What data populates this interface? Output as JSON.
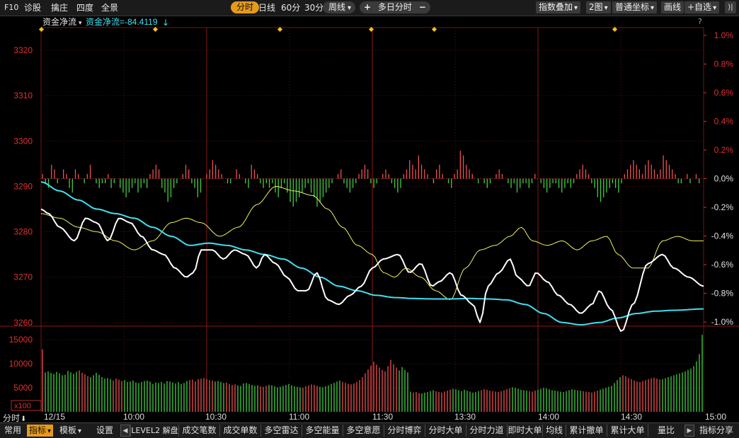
{
  "toolbar": {
    "f10": "F10",
    "diagnose": "诊股",
    "dragon": "擒庄",
    "four_degree": "四度",
    "panorama": "全景",
    "tabs": [
      {
        "label": "分时",
        "active": true
      },
      {
        "label": "日线",
        "active": false
      },
      {
        "label": "60分",
        "active": false
      },
      {
        "label": "30分",
        "active": false
      },
      {
        "label": "周线",
        "active": false
      }
    ],
    "multi_day": "多日分时",
    "plus_glyph": "+",
    "minus_glyph": "−",
    "index_overlay": "指数叠加",
    "two_charts": "2图",
    "coord_mode": "普通坐标",
    "draw_line": "画线",
    "self_select": "+自选",
    "collapse_glyph": "⟩|",
    "dropdown_glyph": "▾"
  },
  "legend": {
    "indicator_name": "资金净流",
    "indicator_value": "资金净流=-84.4119",
    "value_arrow": "↓",
    "help": "?"
  },
  "colors": {
    "price_line": "#ffffff",
    "avg_line": "#f0f060",
    "fund_line": "#40e0f0",
    "up": "#f05050",
    "down": "#40d040",
    "grid": "#7a1010",
    "axis_red": "#e03030",
    "accent": "#e79a1a",
    "marker": "#f0c020"
  },
  "chart_data": {
    "type": "line",
    "price_axis": {
      "ticks": [
        3320,
        3310,
        3300,
        3290,
        3280,
        3270,
        3260
      ],
      "ylim": [
        3259.5,
        3325
      ]
    },
    "pct_axis": {
      "ticks": [
        "1.0%",
        "0.8%",
        "0.6%",
        "0.4%",
        "0.2%",
        "0.0%",
        "-0.2%",
        "-0.4%",
        "-0.6%",
        "-0.8%",
        "-1.0%"
      ]
    },
    "time_ticks": [
      "12/15",
      "10:00",
      "10:30",
      "11:00",
      "11:30",
      "13:30",
      "14:00",
      "14:30",
      "15:00"
    ],
    "time_label": "分时",
    "time_arrow": "⬇",
    "n_points": 241,
    "price_series": {
      "anchors": [
        [
          0,
          3285
        ],
        [
          4,
          3284
        ],
        [
          10,
          3281
        ],
        [
          18,
          3278
        ],
        [
          24,
          3283
        ],
        [
          30,
          3282
        ],
        [
          36,
          3278
        ],
        [
          42,
          3283
        ],
        [
          48,
          3282
        ],
        [
          54,
          3279
        ],
        [
          60,
          3276
        ],
        [
          66,
          3275
        ],
        [
          72,
          3272
        ],
        [
          78,
          3270
        ],
        [
          82,
          3271
        ],
        [
          86,
          3276
        ],
        [
          92,
          3276
        ],
        [
          98,
          3274
        ],
        [
          104,
          3276
        ],
        [
          110,
          3275
        ],
        [
          116,
          3272
        ],
        [
          120,
          3275
        ],
        [
          126,
          3273
        ],
        [
          132,
          3270
        ],
        [
          138,
          3267
        ],
        [
          143,
          3267
        ],
        [
          148,
          3271
        ],
        [
          154,
          3265
        ],
        [
          160,
          3264
        ],
        [
          166,
          3266
        ],
        [
          172,
          3268
        ],
        [
          178,
          3272
        ],
        [
          184,
          3274
        ],
        [
          192,
          3275
        ],
        [
          198,
          3271
        ],
        [
          204,
          3273
        ],
        [
          210,
          3268
        ],
        [
          214,
          3269
        ],
        [
          220,
          3271
        ],
        [
          226,
          3266
        ],
        [
          232,
          3264
        ],
        [
          236,
          3260
        ],
        [
          240,
          3268
        ],
        [
          246,
          3271
        ],
        [
          252,
          3274
        ],
        [
          256,
          3270
        ],
        [
          262,
          3268
        ],
        [
          266,
          3271
        ],
        [
          272,
          3269
        ],
        [
          278,
          3266
        ],
        [
          284,
          3264
        ],
        [
          290,
          3262
        ],
        [
          296,
          3264
        ],
        [
          300,
          3267
        ],
        [
          306,
          3263
        ],
        [
          312,
          3258
        ],
        [
          318,
          3264
        ],
        [
          326,
          3273
        ],
        [
          334,
          3275
        ],
        [
          340,
          3272
        ],
        [
          348,
          3270
        ],
        [
          356,
          3268
        ]
      ],
      "display_points": 241
    },
    "avg_series": {
      "anchors": [
        [
          0,
          3291
        ],
        [
          10,
          3289
        ],
        [
          20,
          3287
        ],
        [
          30,
          3285
        ],
        [
          40,
          3284
        ],
        [
          50,
          3283
        ],
        [
          60,
          3281
        ],
        [
          70,
          3279
        ],
        [
          80,
          3277
        ],
        [
          90,
          3277.5
        ],
        [
          100,
          3277
        ],
        [
          110,
          3276
        ],
        [
          120,
          3275
        ],
        [
          130,
          3274
        ],
        [
          140,
          3272
        ],
        [
          150,
          3270
        ],
        [
          160,
          3268
        ],
        [
          170,
          3267
        ],
        [
          180,
          3266
        ],
        [
          190,
          3265.5
        ],
        [
          200,
          3265.3
        ],
        [
          210,
          3265.2
        ],
        [
          220,
          3265.2
        ],
        [
          230,
          3265.3
        ],
        [
          240,
          3265.2
        ],
        [
          250,
          3265
        ],
        [
          260,
          3264
        ],
        [
          270,
          3262
        ],
        [
          280,
          3260
        ],
        [
          290,
          3259.5
        ],
        [
          300,
          3260
        ],
        [
          310,
          3261
        ],
        [
          320,
          3262
        ],
        [
          330,
          3262.5
        ],
        [
          340,
          3262.7
        ],
        [
          356,
          3263
        ]
      ],
      "display_points": 241
    },
    "fund_series": {
      "anchors": [
        [
          0,
          3284
        ],
        [
          10,
          3283
        ],
        [
          20,
          3281
        ],
        [
          30,
          3280
        ],
        [
          40,
          3278
        ],
        [
          50,
          3276
        ],
        [
          60,
          3278
        ],
        [
          70,
          3282
        ],
        [
          78,
          3283
        ],
        [
          86,
          3282
        ],
        [
          96,
          3279
        ],
        [
          106,
          3281
        ],
        [
          116,
          3286
        ],
        [
          126,
          3290
        ],
        [
          136,
          3289
        ],
        [
          146,
          3288
        ],
        [
          154,
          3285
        ],
        [
          162,
          3281
        ],
        [
          170,
          3277
        ],
        [
          178,
          3275
        ],
        [
          184,
          3271
        ],
        [
          190,
          3270
        ],
        [
          196,
          3272
        ],
        [
          204,
          3270
        ],
        [
          212,
          3267
        ],
        [
          220,
          3265
        ],
        [
          228,
          3272
        ],
        [
          236,
          3276
        ],
        [
          244,
          3277
        ],
        [
          252,
          3279
        ],
        [
          258,
          3281
        ],
        [
          264,
          3278
        ],
        [
          272,
          3277
        ],
        [
          280,
          3278
        ],
        [
          288,
          3276
        ],
        [
          296,
          3278
        ],
        [
          304,
          3279
        ],
        [
          310,
          3275
        ],
        [
          318,
          3272
        ],
        [
          326,
          3272
        ],
        [
          334,
          3278
        ],
        [
          342,
          3279
        ],
        [
          350,
          3278
        ],
        [
          356,
          3278
        ]
      ],
      "display_points": 241
    },
    "flow_bars": {
      "note": "rendered as red (positive) / green (negative) small bars around the 0.0% line",
      "values": [
        1,
        -1,
        -2,
        3,
        2,
        -1,
        0,
        2,
        1,
        -2,
        -3,
        2,
        1,
        0,
        -1,
        1,
        3,
        0,
        -1,
        -2,
        -1,
        -1,
        1,
        -2,
        -1,
        0,
        -2,
        -3,
        -4,
        -3,
        -2,
        -1,
        -3,
        -2,
        -1,
        -2,
        1,
        2,
        3,
        2,
        -2,
        -3,
        -5,
        -4,
        -2,
        -1,
        0,
        1,
        3,
        2,
        -1,
        -2,
        -4,
        -3,
        0,
        1,
        2,
        4,
        3,
        2,
        1,
        0,
        -1,
        -1,
        0,
        2,
        1,
        0,
        -1,
        -2,
        3,
        2,
        1,
        -1,
        -2,
        -1,
        -2,
        -1,
        -3,
        -4,
        -2,
        -1,
        -3,
        -5,
        -6,
        -5,
        -4,
        -3,
        -2,
        -1,
        -3,
        -4,
        -6,
        -5,
        -4,
        -3,
        -2,
        -1,
        0,
        1,
        2,
        -1,
        -2,
        -3,
        -2,
        -1,
        1,
        2,
        3,
        2,
        -1,
        -2,
        -1,
        0,
        1,
        2,
        1,
        -1,
        -2,
        -3,
        -2,
        1,
        2,
        4,
        3,
        2,
        5,
        3,
        2,
        1,
        0,
        -1,
        2,
        3,
        1,
        0,
        -1,
        -2,
        1,
        2,
        6,
        5,
        3,
        2,
        1,
        0,
        -1,
        0,
        -1,
        -2,
        -1,
        0,
        1,
        2,
        1,
        0,
        -1,
        -2,
        -1,
        -3,
        -2,
        -1,
        -1,
        -2,
        -1,
        1,
        0,
        -1,
        -2,
        -3,
        -2,
        -1,
        -1,
        -2,
        -3,
        -2,
        -1,
        -2,
        -1,
        1,
        2,
        3,
        2,
        1,
        -1,
        -2,
        -4,
        -5,
        -4,
        -3,
        -2,
        -1,
        -2,
        -3,
        -1,
        1,
        2,
        3,
        4,
        3,
        2,
        1,
        3,
        4,
        3,
        2,
        1,
        2,
        5,
        4,
        3,
        2,
        1,
        -1,
        -1,
        0,
        1,
        -1,
        0,
        1,
        -1,
        0
      ],
      "ymax": 7
    },
    "volume": {
      "ticks": [
        15000,
        10000,
        5000
      ],
      "ylim": [
        0,
        17500
      ],
      "unit": "x100",
      "values": [
        13000,
        8200,
        8400,
        8100,
        7900,
        8300,
        8000,
        7600,
        7700,
        8500,
        8200,
        7900,
        8300,
        8600,
        8100,
        7800,
        7400,
        7200,
        7600,
        8100,
        7700,
        7200,
        6900,
        7000,
        6800,
        6500,
        6900,
        6700,
        6400,
        6600,
        6200,
        6300,
        6500,
        6100,
        6000,
        6200,
        6400,
        6500,
        6300,
        5800,
        6100,
        6000,
        6200,
        5900,
        6400,
        6300,
        6100,
        5900,
        6200,
        5800,
        6000,
        6400,
        6600,
        6700,
        6300,
        6800,
        6900,
        7000,
        6800,
        6600,
        6500,
        6300,
        6400,
        6200,
        6000,
        6100,
        5800,
        5600,
        5700,
        5500,
        5400,
        5900,
        6000,
        5800,
        5600,
        5400,
        5500,
        5300,
        5200,
        5400,
        5600,
        5500,
        5300,
        5100,
        5200,
        5400,
        5600,
        5800,
        5500,
        5300,
        5200,
        5100,
        5000,
        5300,
        5500,
        5700,
        5600,
        5400,
        5200,
        5100,
        5300,
        5500,
        5800,
        6000,
        6300,
        6500,
        6200,
        6000,
        5800,
        5700,
        5900,
        6200,
        6600,
        7200,
        8000,
        8800,
        9600,
        10400,
        9800,
        9200,
        8700,
        8400,
        9500,
        10800,
        9900,
        9200,
        8600,
        9300,
        8700,
        8200,
        4200,
        4000,
        4100,
        3900,
        3800,
        4000,
        4100,
        4300,
        4500,
        4300,
        4100,
        4000,
        4200,
        4400,
        4600,
        4800,
        4700,
        4500,
        4300,
        4600,
        4400,
        4200,
        4000,
        4100,
        4300,
        4500,
        4700,
        4600,
        4400,
        4300,
        4200,
        4100,
        4300,
        4500,
        4700,
        4900,
        5100,
        5000,
        4800,
        4600,
        4500,
        4400,
        4300,
        4200,
        4400,
        4600,
        4800,
        5000,
        4900,
        4700,
        4500,
        4400,
        4300,
        4200,
        4100,
        4300,
        4500,
        4700,
        4600,
        4500,
        4400,
        4300,
        4200,
        4100,
        4000,
        4200,
        4400,
        4600,
        4800,
        5000,
        5200,
        5400,
        6000,
        6600,
        7200,
        7600,
        7400,
        7000,
        6800,
        6500,
        6300,
        6200,
        6400,
        6600,
        6800,
        7000,
        7100,
        6900,
        6700,
        6800,
        7000,
        7200,
        7400,
        7600,
        7800,
        8000,
        8200,
        8400,
        8700,
        9000,
        9500,
        10500,
        12000,
        16000
      ]
    }
  },
  "bottombar": {
    "common": "常用",
    "indicators": "指标",
    "template": "模板",
    "settings": "设置",
    "tabs": [
      "LEVEL2 解盘",
      "成交笔数",
      "成交单数",
      "多空雷达",
      "多空能量",
      "多空意愿",
      "分时博弈",
      "分时大单",
      "分时力道",
      "即时大单",
      "均线",
      "累计撤单",
      "累计大单",
      "量比"
    ],
    "share": "指标分享",
    "left_arrow": "◀",
    "right_arrow": "▶"
  }
}
